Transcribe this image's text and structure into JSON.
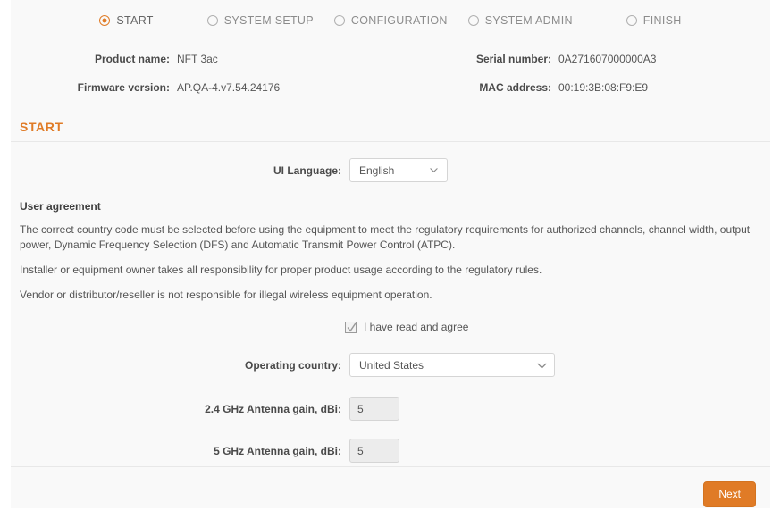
{
  "wizard": {
    "steps": [
      {
        "label": "START",
        "state": "active",
        "icon": "radio-filled-icon"
      },
      {
        "label": "SYSTEM SETUP",
        "state": "inactive",
        "icon": "radio-empty-icon"
      },
      {
        "label": "CONFIGURATION",
        "state": "inactive",
        "icon": "radio-empty-icon"
      },
      {
        "label": "SYSTEM ADMIN",
        "state": "inactive",
        "icon": "radio-empty-icon"
      },
      {
        "label": "FINISH",
        "state": "inactive",
        "icon": "radio-empty-icon"
      }
    ]
  },
  "device_info": {
    "product_name_label": "Product name:",
    "product_name_value": "NFT 3ac",
    "serial_number_label": "Serial number:",
    "serial_number_value": "0A271607000000A3",
    "firmware_version_label": "Firmware version:",
    "firmware_version_value": "AP.QA-4.v7.54.24176",
    "mac_address_label": "MAC address:",
    "mac_address_value": "00:19:3B:08:F9:E9"
  },
  "section": {
    "title": "START"
  },
  "form": {
    "ui_language_label": "UI Language:",
    "ui_language_value": "English",
    "operating_country_label": "Operating country:",
    "operating_country_value": "United States",
    "gain_24_label": "2.4 GHz Antenna gain, dBi:",
    "gain_24_value": "5",
    "gain_5_label": "5 GHz Antenna gain, dBi:",
    "gain_5_value": "5"
  },
  "agreement": {
    "heading": "User agreement",
    "paragraphs": [
      "The correct country code must be selected before using the equipment to meet the regulatory requirements for authorized channels, channel width, output power, Dynamic Frequency Selection (DFS) and Automatic Transmit Power Control (ATPC).",
      "Installer or equipment owner takes all responsibility for proper product usage according to the regulatory rules.",
      "Vendor or distributor/reseller is not responsible for illegal wireless equipment operation."
    ],
    "checkbox_label": "I have read and agree",
    "checkbox_checked": "true"
  },
  "footer": {
    "next_label": "Next"
  },
  "colors": {
    "accent": "#e07b26",
    "text": "#555555",
    "page_bg": "#f9f9f9",
    "border": "#e8e8e8"
  }
}
